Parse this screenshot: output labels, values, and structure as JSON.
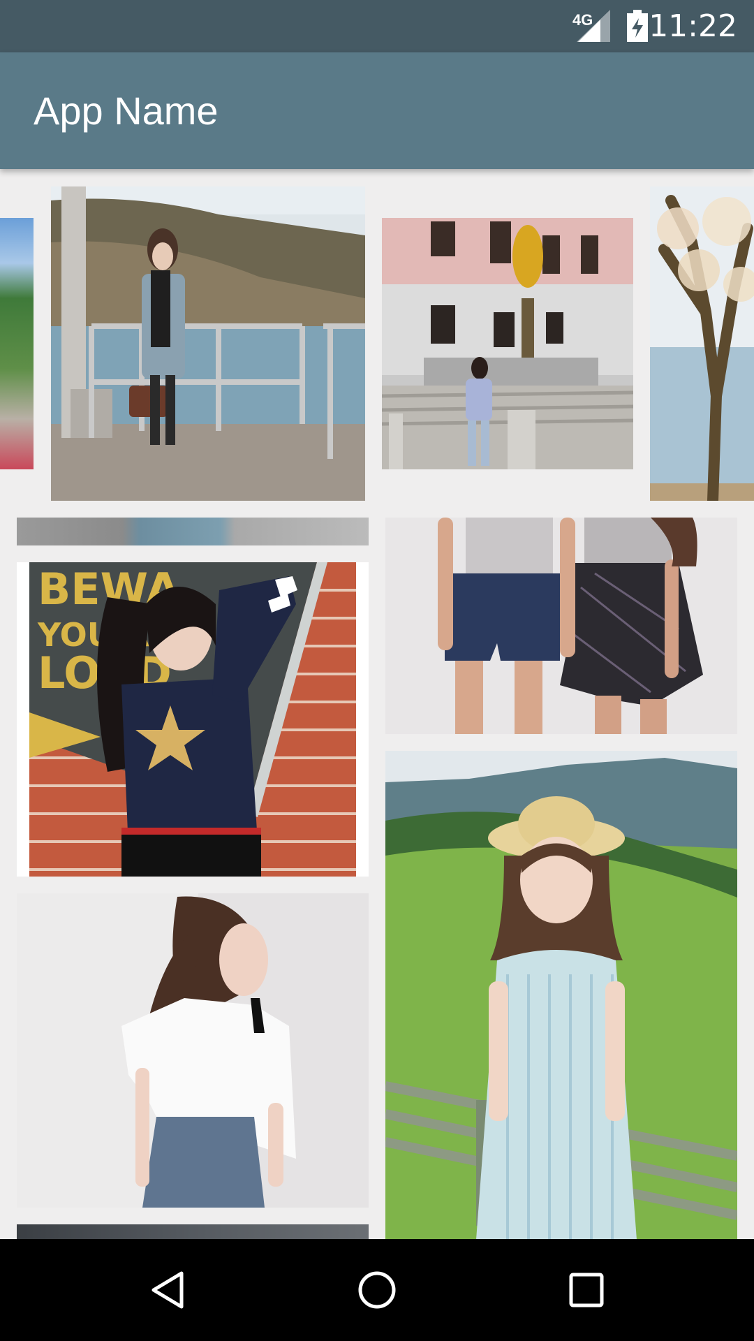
{
  "status_bar": {
    "network": "4G",
    "time": "11:22",
    "icons": [
      "signal-icon",
      "battery-charging-icon"
    ]
  },
  "app_bar": {
    "title": "App Name"
  },
  "carousel": {
    "items": [
      "carousel-photo-left-partial",
      "carousel-photo-pier",
      "carousel-photo-fountain",
      "carousel-photo-tree-partial"
    ]
  },
  "grid": {
    "items": [
      "grid-photo-partial-top",
      "grid-photo-shorts",
      "grid-photo-star-sweater",
      "grid-photo-meadow-hat",
      "grid-photo-white-top",
      "grid-photo-partial-bottom"
    ]
  },
  "nav_bar": {
    "icons": [
      "back-icon",
      "home-icon",
      "recents-icon"
    ]
  },
  "colors": {
    "status_bar": "#455a64",
    "app_bar": "#5a7a88",
    "background": "#efeeee",
    "nav_bar": "#000000"
  }
}
